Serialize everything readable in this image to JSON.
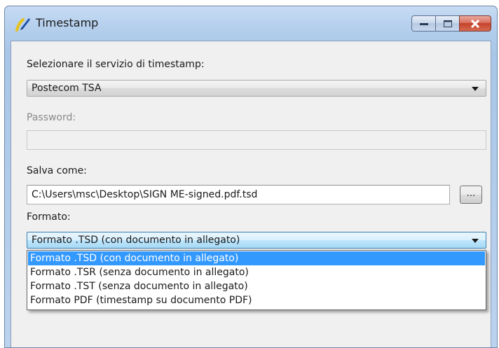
{
  "window": {
    "title": "Timestamp",
    "accent": "#3399ff"
  },
  "caption_buttons": {
    "minimize_icon": "minimize-icon",
    "maximize_icon": "maximize-icon",
    "close_icon": "close-icon"
  },
  "service": {
    "label": "Selezionare il servizio di timestamp:",
    "selected": "Postecom TSA"
  },
  "password": {
    "label": "Password:",
    "value": ""
  },
  "save_as": {
    "label": "Salva come:",
    "value": "C:\\Users\\msc\\Desktop\\SIGN ME-signed.pdf.tsd",
    "browse_label": "..."
  },
  "format": {
    "label": "Formato:",
    "selected": "Formato .TSD (con documento in allegato)",
    "options": [
      "Formato .TSD (con documento in allegato)",
      "Formato .TSR (senza documento in allegato)",
      "Formato .TST (senza documento in allegato)",
      "Formato PDF (timestamp su documento PDF)"
    ],
    "highlighted_index": 0
  }
}
